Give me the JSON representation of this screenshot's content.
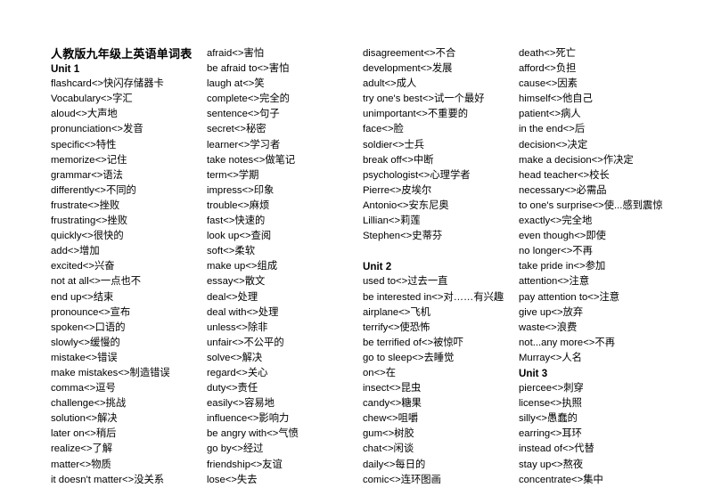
{
  "document": {
    "title": "人教版九年级上英语单词表",
    "separator": "<>"
  },
  "columns": [
    {
      "name": "column-1",
      "rows": [
        {
          "type": "doc-title",
          "text": "人教版九年级上英语单词表"
        },
        {
          "type": "unit",
          "text": "Unit 1"
        },
        {
          "type": "entry",
          "text": "flashcard<>快闪存储器卡"
        },
        {
          "type": "entry",
          "text": "Vocabulary<>字汇"
        },
        {
          "type": "entry",
          "text": "aloud<>大声地"
        },
        {
          "type": "entry",
          "text": "pronunciation<>发音"
        },
        {
          "type": "entry",
          "text": "specific<>特性"
        },
        {
          "type": "entry",
          "text": "memorize<>记住"
        },
        {
          "type": "entry",
          "text": "grammar<>语法"
        },
        {
          "type": "entry",
          "text": "differently<>不同的"
        },
        {
          "type": "entry",
          "text": "frustrate<>挫败"
        },
        {
          "type": "entry",
          "text": "frustrating<>挫败"
        },
        {
          "type": "entry",
          "text": "quickly<>很快的"
        },
        {
          "type": "entry",
          "text": "add<>增加"
        },
        {
          "type": "entry",
          "text": "excited<>兴奋"
        },
        {
          "type": "entry",
          "text": "not at all<>一点也不"
        },
        {
          "type": "entry",
          "text": "end up<>结束"
        },
        {
          "type": "entry",
          "text": "pronounce<>宣布"
        },
        {
          "type": "entry",
          "text": "spoken<>口语的"
        },
        {
          "type": "entry",
          "text": "slowly<>缓慢的"
        },
        {
          "type": "entry",
          "text": "mistake<>错误"
        },
        {
          "type": "entry",
          "text": "make mistakes<>制造错误"
        },
        {
          "type": "entry",
          "text": "comma<>逗号"
        },
        {
          "type": "entry",
          "text": "challenge<>挑战"
        },
        {
          "type": "entry",
          "text": "solution<>解决"
        },
        {
          "type": "entry",
          "text": "later on<>稍后"
        },
        {
          "type": "entry",
          "text": "realize<>了解"
        },
        {
          "type": "entry",
          "text": "matter<>物质"
        },
        {
          "type": "entry",
          "text": "it doesn't matter<>没关系"
        }
      ]
    },
    {
      "name": "column-2",
      "rows": [
        {
          "type": "entry",
          "text": "afraid<>害怕"
        },
        {
          "type": "entry",
          "text": "be afraid to<>害怕"
        },
        {
          "type": "entry",
          "text": "laugh at<>笑"
        },
        {
          "type": "entry",
          "text": "complete<>完全的"
        },
        {
          "type": "entry",
          "text": "sentence<>句子"
        },
        {
          "type": "entry",
          "text": "secret<>秘密"
        },
        {
          "type": "entry",
          "text": "learner<>学习者"
        },
        {
          "type": "entry",
          "text": "take notes<>做笔记"
        },
        {
          "type": "entry",
          "text": "term<>学期"
        },
        {
          "type": "entry",
          "text": "impress<>印象"
        },
        {
          "type": "entry",
          "text": "trouble<>麻烦"
        },
        {
          "type": "entry",
          "text": "fast<>快速的"
        },
        {
          "type": "entry",
          "text": "look up<>查阅"
        },
        {
          "type": "entry",
          "text": "soft<>柔软"
        },
        {
          "type": "entry",
          "text": "make up<>组成"
        },
        {
          "type": "entry",
          "text": "essay<>散文"
        },
        {
          "type": "entry",
          "text": "deal<>处理"
        },
        {
          "type": "entry",
          "text": "deal with<>处理"
        },
        {
          "type": "entry",
          "text": "unless<>除非"
        },
        {
          "type": "entry",
          "text": "unfair<>不公平的"
        },
        {
          "type": "entry",
          "text": "solve<>解决"
        },
        {
          "type": "entry",
          "text": "regard<>关心"
        },
        {
          "type": "entry",
          "text": "duty<>责任"
        },
        {
          "type": "entry",
          "text": "easily<>容易地"
        },
        {
          "type": "entry",
          "text": "influence<>影响力"
        },
        {
          "type": "entry",
          "text": "be angry with<>气愤"
        },
        {
          "type": "entry",
          "text": "go by<>经过"
        },
        {
          "type": "entry",
          "text": "friendship<>友谊"
        },
        {
          "type": "entry",
          "text": "lose<>失去"
        }
      ]
    },
    {
      "name": "column-3",
      "rows": [
        {
          "type": "entry",
          "text": "disagreement<>不合"
        },
        {
          "type": "entry",
          "text": "development<>发展"
        },
        {
          "type": "entry",
          "text": "adult<>成人"
        },
        {
          "type": "entry",
          "text": "try one's best<>试一个最好"
        },
        {
          "type": "entry",
          "text": "unimportant<>不重要的"
        },
        {
          "type": "entry",
          "text": "face<>脸"
        },
        {
          "type": "entry",
          "text": "soldier<>士兵"
        },
        {
          "type": "entry",
          "text": "break off<>中断"
        },
        {
          "type": "entry",
          "text": "psychologist<>心理学者"
        },
        {
          "type": "entry",
          "text": "Pierre<>皮埃尔"
        },
        {
          "type": "entry",
          "text": "Antonio<>安东尼奥"
        },
        {
          "type": "entry",
          "text": "Lillian<>莉莲"
        },
        {
          "type": "entry",
          "text": "Stephen<>史蒂芬"
        },
        {
          "type": "blank",
          "text": ""
        },
        {
          "type": "unit",
          "text": "Unit 2"
        },
        {
          "type": "entry",
          "text": "used to<>过去一直"
        },
        {
          "type": "entry",
          "text": "be interested in<>对……有兴趣"
        },
        {
          "type": "entry",
          "text": "airplane<>飞机"
        },
        {
          "type": "entry",
          "text": "terrify<>使恐怖"
        },
        {
          "type": "entry",
          "text": "be terrified of<>被惊吓"
        },
        {
          "type": "entry",
          "text": "go to sleep<>去睡觉"
        },
        {
          "type": "entry",
          "text": "on<>在"
        },
        {
          "type": "entry",
          "text": "insect<>昆虫"
        },
        {
          "type": "entry",
          "text": "candy<>糖果"
        },
        {
          "type": "entry",
          "text": "chew<>咀嚼"
        },
        {
          "type": "entry",
          "text": "gum<>树胶"
        },
        {
          "type": "entry",
          "text": "chat<>闲谈"
        },
        {
          "type": "entry",
          "text": "daily<>每日的"
        },
        {
          "type": "entry",
          "text": "comic<>连环图画"
        }
      ]
    },
    {
      "name": "column-4",
      "rows": [
        {
          "type": "entry",
          "text": "death<>死亡"
        },
        {
          "type": "entry",
          "text": "afford<>负担"
        },
        {
          "type": "entry",
          "text": "cause<>因素"
        },
        {
          "type": "entry",
          "text": "himself<>他自己"
        },
        {
          "type": "entry",
          "text": "patient<>病人"
        },
        {
          "type": "entry",
          "text": "in the end<>后"
        },
        {
          "type": "entry",
          "text": "decision<>决定"
        },
        {
          "type": "entry",
          "text": "make a decision<>作决定"
        },
        {
          "type": "entry",
          "text": "head teacher<>校长"
        },
        {
          "type": "entry",
          "text": "necessary<>必需品"
        },
        {
          "type": "entry",
          "text": "to one's surprise<>使...感到震惊"
        },
        {
          "type": "entry",
          "text": "exactly<>完全地"
        },
        {
          "type": "entry",
          "text": "even though<>即使"
        },
        {
          "type": "entry",
          "text": "no longer<>不再"
        },
        {
          "type": "entry",
          "text": "take pride in<>参加"
        },
        {
          "type": "entry",
          "text": "attention<>注意"
        },
        {
          "type": "entry",
          "text": "pay attention to<>注意"
        },
        {
          "type": "entry",
          "text": "give up<>放弃"
        },
        {
          "type": "entry",
          "text": "waste<>浪费"
        },
        {
          "type": "entry",
          "text": "not...any more<>不再"
        },
        {
          "type": "entry",
          "text": "Murray<>人名"
        },
        {
          "type": "unit",
          "text": "Unit 3"
        },
        {
          "type": "entry",
          "text": "piercee<>刺穿"
        },
        {
          "type": "entry",
          "text": "license<>执照"
        },
        {
          "type": "entry",
          "text": "silly<>愚蠢的"
        },
        {
          "type": "entry",
          "text": "earring<>耳环"
        },
        {
          "type": "entry",
          "text": "instead of<>代替"
        },
        {
          "type": "entry",
          "text": "stay up<>熬夜"
        },
        {
          "type": "entry",
          "text": "concentrate<>集中"
        }
      ]
    }
  ]
}
